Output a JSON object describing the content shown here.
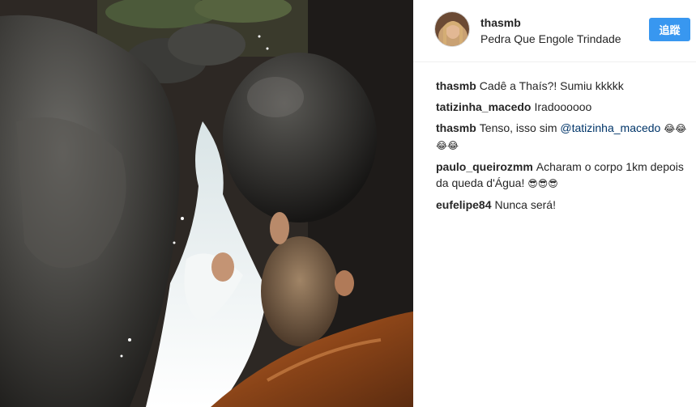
{
  "header": {
    "username": "thasmb",
    "location": "Pedra Que Engole Trindade",
    "follow_label": "追蹤"
  },
  "comments": [
    {
      "user": "thasmb",
      "text": "Cadê a Thaís?! Sumiu kkkkk"
    },
    {
      "user": "tatizinha_macedo",
      "text": "Iradoooooo"
    },
    {
      "user": "thasmb",
      "text_before": "Tenso, isso sim",
      "mention": "@tatizinha_macedo",
      "emoji": "😂😂😂😂"
    },
    {
      "user": "paulo_queirozmm",
      "text": "Acharam o corpo 1km depois da queda d'Água!",
      "emoji": "😎😎😎"
    },
    {
      "user": "eufelipe84",
      "text": "Nunca será!"
    }
  ],
  "colors": {
    "follow_button": "#3897f0",
    "mention": "#003569",
    "text": "#262626"
  },
  "icons": {
    "avatar": "profile-photo"
  }
}
